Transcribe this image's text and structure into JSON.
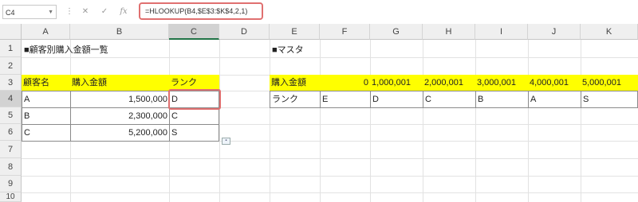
{
  "formula_bar": {
    "name_box": "C4",
    "formula": "=HLOOKUP(B4,$E$3:$K$4,2,1)",
    "cancel_glyph": "✕",
    "enter_glyph": "✓",
    "fx_glyph": "fx"
  },
  "columns": [
    "A",
    "B",
    "C",
    "D",
    "E",
    "F",
    "G",
    "H",
    "I",
    "J",
    "K"
  ],
  "rows": [
    "1",
    "2",
    "3",
    "4",
    "5",
    "6",
    "7",
    "8",
    "9",
    "10"
  ],
  "left_table": {
    "title": "■顧客別購入金額一覧",
    "headers": [
      "顧客名",
      "購入金額",
      "ランク"
    ],
    "rows": [
      {
        "name": "A",
        "amount": "1,500,000",
        "rank": "D"
      },
      {
        "name": "B",
        "amount": "2,300,000",
        "rank": "C"
      },
      {
        "name": "C",
        "amount": "5,200,000",
        "rank": "S"
      }
    ]
  },
  "master_table": {
    "title": "■マスタ",
    "row_labels": [
      "購入金額",
      "ランク"
    ],
    "amounts": [
      "0",
      "1,000,001",
      "2,000,001",
      "3,000,001",
      "4,000,001",
      "5,000,001"
    ],
    "ranks": [
      "E",
      "D",
      "C",
      "B",
      "A",
      "S"
    ]
  },
  "colors": {
    "header_fill": "#ffff00",
    "highlight_border": "#e07070",
    "selected_header": "#d2d2d2"
  },
  "icons": [
    "dropdown-arrow-icon",
    "cancel-icon",
    "enter-icon",
    "function-icon",
    "paste-options-icon"
  ]
}
